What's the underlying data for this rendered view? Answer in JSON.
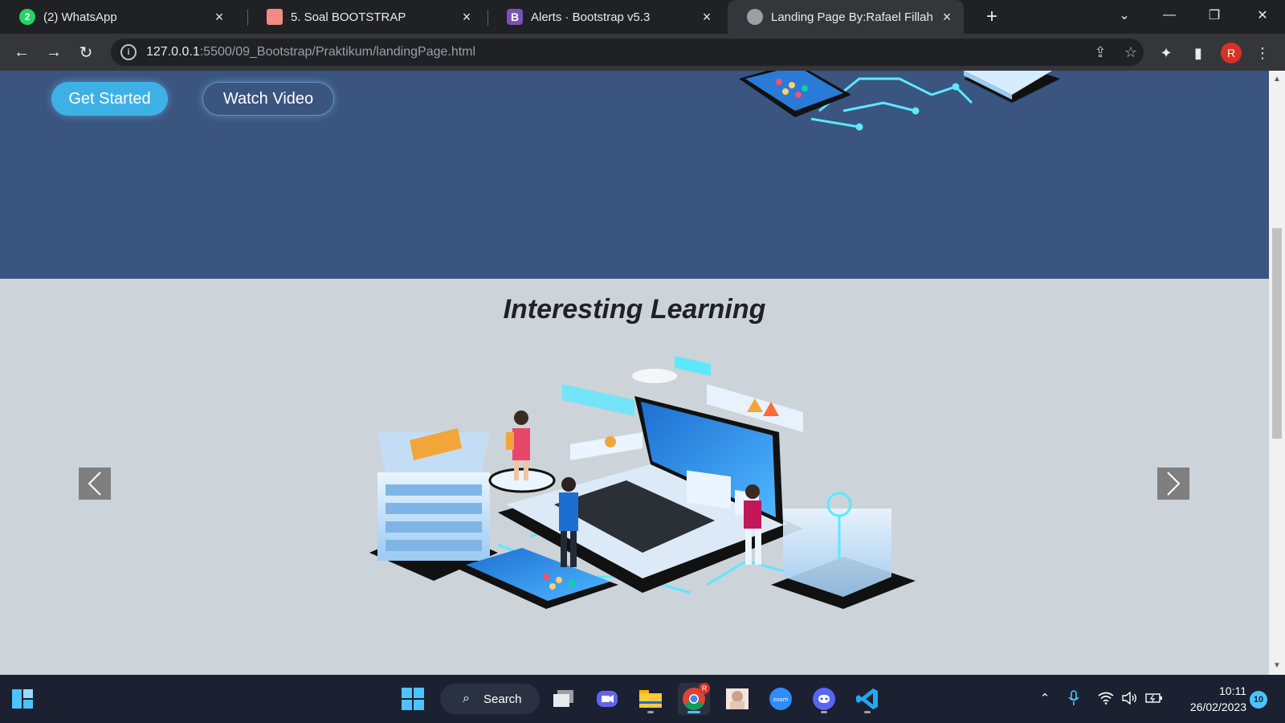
{
  "browser": {
    "tabs": [
      {
        "title": "(2) WhatsApp",
        "icon": "whatsapp-icon",
        "badge": "2"
      },
      {
        "title": "5. Soal BOOTSTRAP",
        "icon": "document-icon"
      },
      {
        "title": "Alerts · Bootstrap v5.3",
        "icon": "bootstrap-icon",
        "badge": "B"
      },
      {
        "title": "Landing Page By:Rafael Fillah",
        "icon": "globe-icon",
        "active": true
      }
    ],
    "url_host": "127.0.0.1",
    "url_path": ":5500/09_Bootstrap/Praktikum/landingPage.html",
    "profile_initial": "R"
  },
  "page": {
    "hero": {
      "get_started_label": "Get Started",
      "watch_video_label": "Watch Video",
      "background_color": "#3a557f",
      "accent_color": "#3db1e6"
    },
    "section": {
      "title": "Interesting Learning"
    },
    "carousel": {
      "prev_icon": "chevron-left-icon",
      "next_icon": "chevron-right-icon"
    }
  },
  "taskbar": {
    "search_label": "Search",
    "chrome_badge": "R",
    "time": "10:11",
    "date": "26/02/2023",
    "notification_count": "10"
  }
}
